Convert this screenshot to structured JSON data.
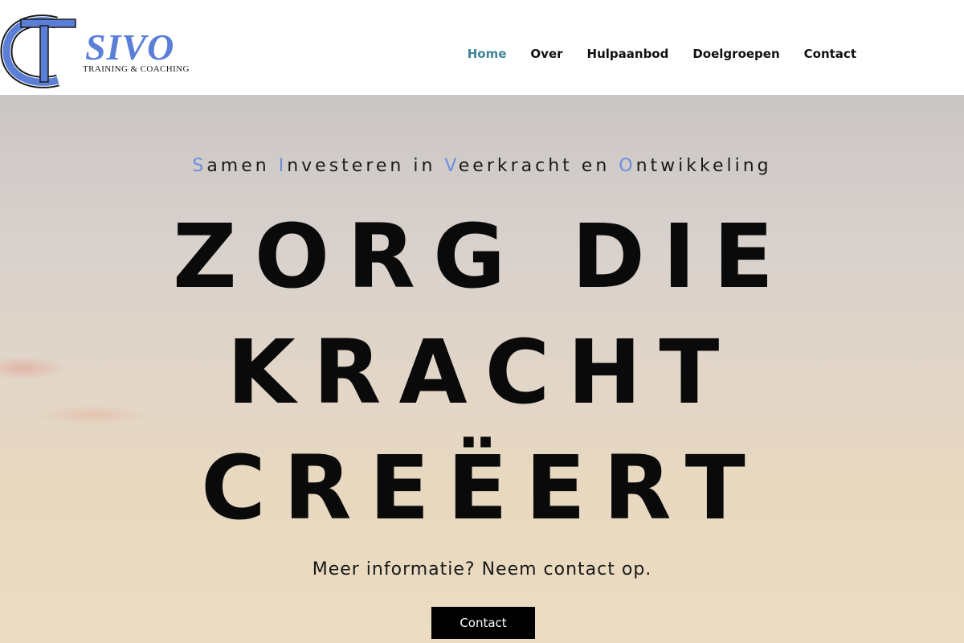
{
  "header": {
    "logo": {
      "name": "SIVO",
      "subtitle": "TRAINING & COACHING",
      "mark_letters": "CT"
    },
    "nav": [
      {
        "label": "Home",
        "active": true
      },
      {
        "label": "Over"
      },
      {
        "label": "Hulpaanbod"
      },
      {
        "label": "Doelgroepen"
      },
      {
        "label": "Contact"
      }
    ],
    "colors": {
      "logo_blue": "#5b7fd6",
      "nav_active": "#3e8599"
    }
  },
  "hero": {
    "tagline": [
      {
        "initial": "S",
        "rest": "amen "
      },
      {
        "initial": "I",
        "rest": "nvesteren in "
      },
      {
        "initial": "V",
        "rest": "eerkracht en "
      },
      {
        "initial": "O",
        "rest": "ntwikkeling"
      }
    ],
    "headline": [
      "ZORG DIE",
      "KRACHT",
      "CREËERT"
    ],
    "subtext": "Meer informatie? Neem contact op.",
    "cta_label": "Contact",
    "colors": {
      "tagline_initials": "#6d8ee0",
      "cta_bg": "#000000"
    }
  }
}
